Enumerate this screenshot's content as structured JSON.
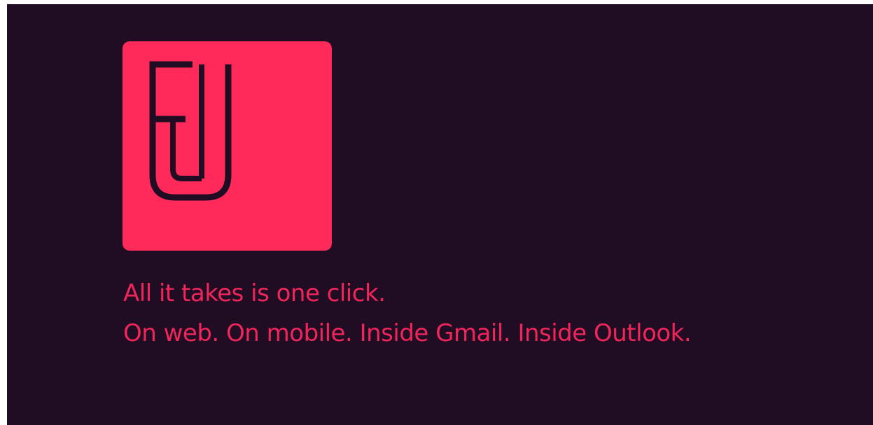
{
  "logo": {
    "icon": "fj-monogram-logo",
    "tile_color": "#ff2a5a",
    "glyph_color": "#200d24"
  },
  "background_color": "#200d24",
  "tagline": {
    "line1": "All it takes is one click.",
    "line2": "On web. On mobile. Inside Gmail. Inside Outlook.",
    "color": "#f0255a"
  }
}
